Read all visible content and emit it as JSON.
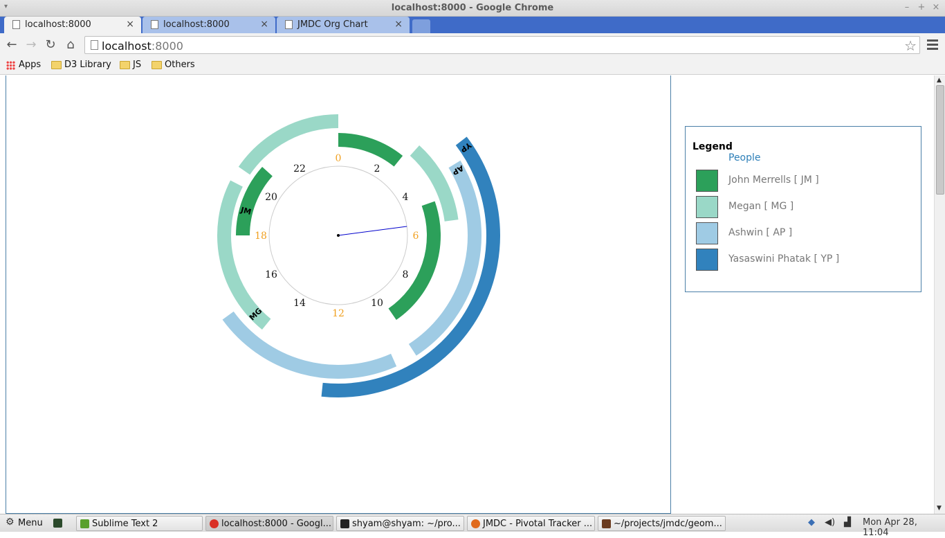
{
  "window": {
    "title": "localhost:8000 - Google Chrome"
  },
  "tabs": [
    {
      "label": "localhost:8000",
      "active": true
    },
    {
      "label": "localhost:8000",
      "active": false
    },
    {
      "label": "JMDC Org Chart",
      "active": false
    }
  ],
  "toolbar": {
    "url_host": "localhost",
    "url_port": ":8000"
  },
  "bookmarks": [
    {
      "label": "Apps",
      "icon": "apps-grid-icon"
    },
    {
      "label": "D3 Library",
      "icon": "folder-icon"
    },
    {
      "label": "JS",
      "icon": "folder-icon"
    },
    {
      "label": "Others",
      "icon": "folder-icon"
    }
  ],
  "legend": {
    "title": "Legend",
    "group": "People",
    "items": [
      {
        "label": "John Merrells [ JM ]",
        "color": "#2ca05a"
      },
      {
        "label": "Megan [ MG ]",
        "color": "#9ad8c7"
      },
      {
        "label": "Ashwin [ AP ]",
        "color": "#9fcbe4"
      },
      {
        "label": "Yasaswini Phatak [ YP ]",
        "color": "#3182bd"
      }
    ]
  },
  "chart_data": {
    "type": "radial-timeline",
    "clock_hours": [
      "0",
      "2",
      "4",
      "6",
      "8",
      "10",
      "12",
      "14",
      "16",
      "18",
      "20",
      "22"
    ],
    "highlight_hours": [
      "0",
      "6",
      "12",
      "18"
    ],
    "hand_hour": 5.5,
    "people": [
      {
        "code": "JM",
        "name": "John Merrells",
        "color": "#2ca05a",
        "ring": 1,
        "spans": [
          [
            0,
            2.6
          ],
          [
            4.7,
            9.7
          ],
          [
            18,
            20.8
          ]
        ]
      },
      {
        "code": "MG",
        "name": "Megan",
        "color": "#9ad8c7",
        "ring": 2,
        "spans": [
          [
            20.3,
            24
          ],
          [
            2.8,
            5.5
          ],
          [
            14.6,
            19.8
          ]
        ]
      },
      {
        "code": "AP",
        "name": "Ashwin",
        "color": "#9fcbe4",
        "ring": 3,
        "spans": [
          [
            3.9,
            9.8
          ],
          [
            10.4,
            15.6
          ]
        ]
      },
      {
        "code": "YP",
        "name": "Yasaswini Phatak",
        "color": "#3182bd",
        "ring": 4,
        "spans": [
          [
            3.5,
            12.4
          ]
        ]
      }
    ]
  },
  "taskbar": {
    "menu_label": "Menu",
    "items": [
      {
        "label": "Sublime Text 2",
        "color": "#5aa02c"
      },
      {
        "label": "localhost:8000 - Googl...",
        "color": "#d93025",
        "active": true
      },
      {
        "label": "shyam@shyam: ~/pro...",
        "color": "#222222"
      },
      {
        "label": "JMDC - Pivotal Tracker ...",
        "color": "#e06a1c"
      },
      {
        "label": "~/projects/jmdc/geom...",
        "color": "#6b3b1e"
      }
    ],
    "clock": "Mon Apr 28, 11:04"
  }
}
